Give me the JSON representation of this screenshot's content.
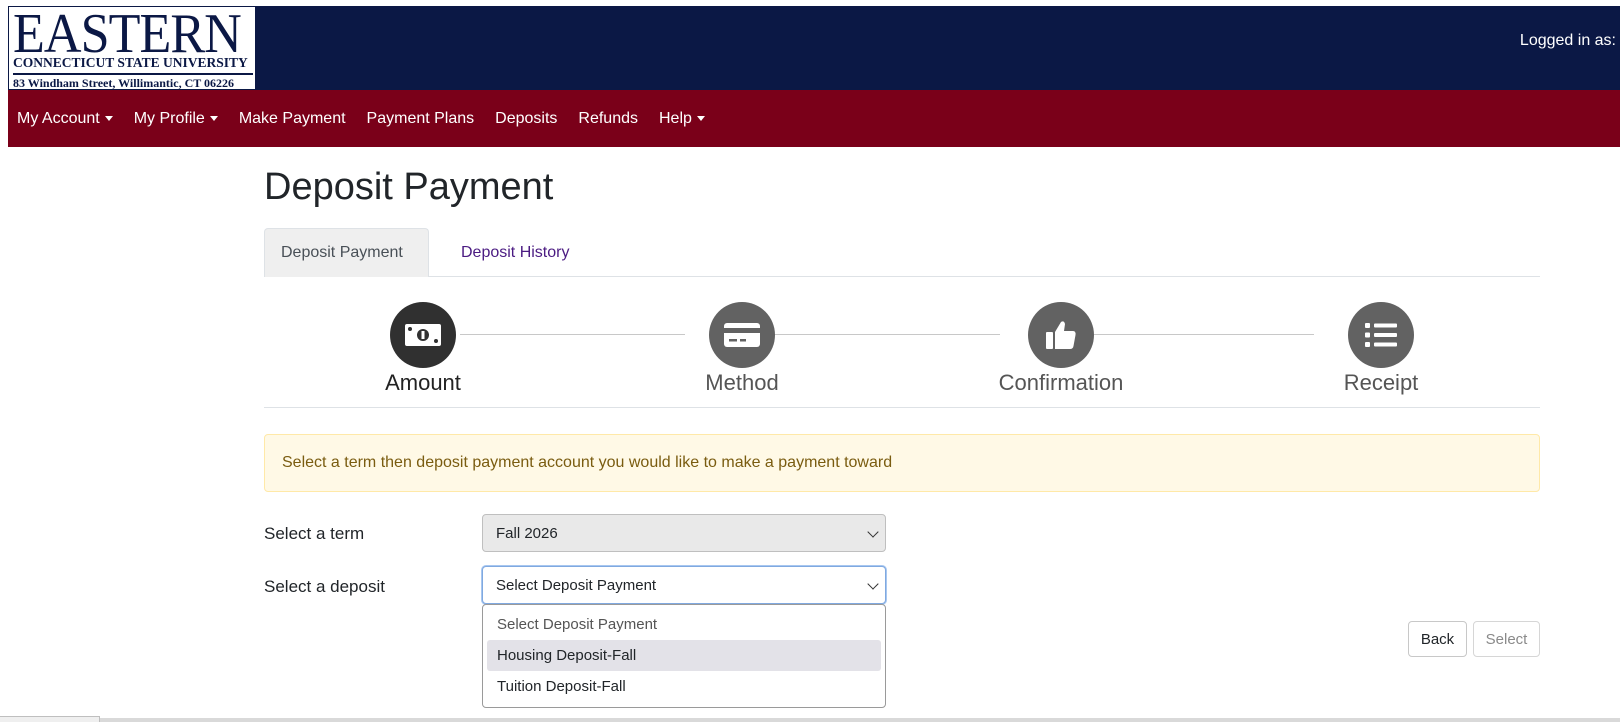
{
  "header": {
    "logo_main": "EASTERN",
    "logo_sub": "CONNECTICUT STATE UNIVERSITY",
    "logo_address": "83 Windham Street, Willimantic, CT 06226",
    "logged_in_label": "Logged in as:",
    "bg_color": "#0b1845"
  },
  "nav": {
    "bg_color": "#7a0019",
    "items": [
      {
        "label": "My Account",
        "dropdown": true
      },
      {
        "label": "My Profile",
        "dropdown": true
      },
      {
        "label": "Make Payment",
        "dropdown": false
      },
      {
        "label": "Payment Plans",
        "dropdown": false
      },
      {
        "label": "Deposits",
        "dropdown": false
      },
      {
        "label": "Refunds",
        "dropdown": false
      },
      {
        "label": "Help",
        "dropdown": true
      }
    ]
  },
  "page": {
    "title": "Deposit Payment",
    "tabs": [
      {
        "label": "Deposit Payment",
        "active": true
      },
      {
        "label": "Deposit History",
        "active": false
      }
    ]
  },
  "steps": [
    {
      "label": "Amount",
      "icon": "money-bill-icon",
      "active": true
    },
    {
      "label": "Method",
      "icon": "credit-card-icon",
      "active": false
    },
    {
      "label": "Confirmation",
      "icon": "thumbs-up-icon",
      "active": false
    },
    {
      "label": "Receipt",
      "icon": "list-icon",
      "active": false
    }
  ],
  "alert": {
    "text": "Select a term then deposit payment account you would like to make a payment toward"
  },
  "form": {
    "term_label": "Select a term",
    "term_value": "Fall 2026",
    "deposit_label": "Select a deposit",
    "deposit_value": "Select Deposit Payment",
    "deposit_options": [
      "Select Deposit Payment",
      "Housing Deposit-Fall",
      "Tuition Deposit-Fall"
    ]
  },
  "buttons": {
    "back_label": "Back",
    "select_label": "Select"
  }
}
